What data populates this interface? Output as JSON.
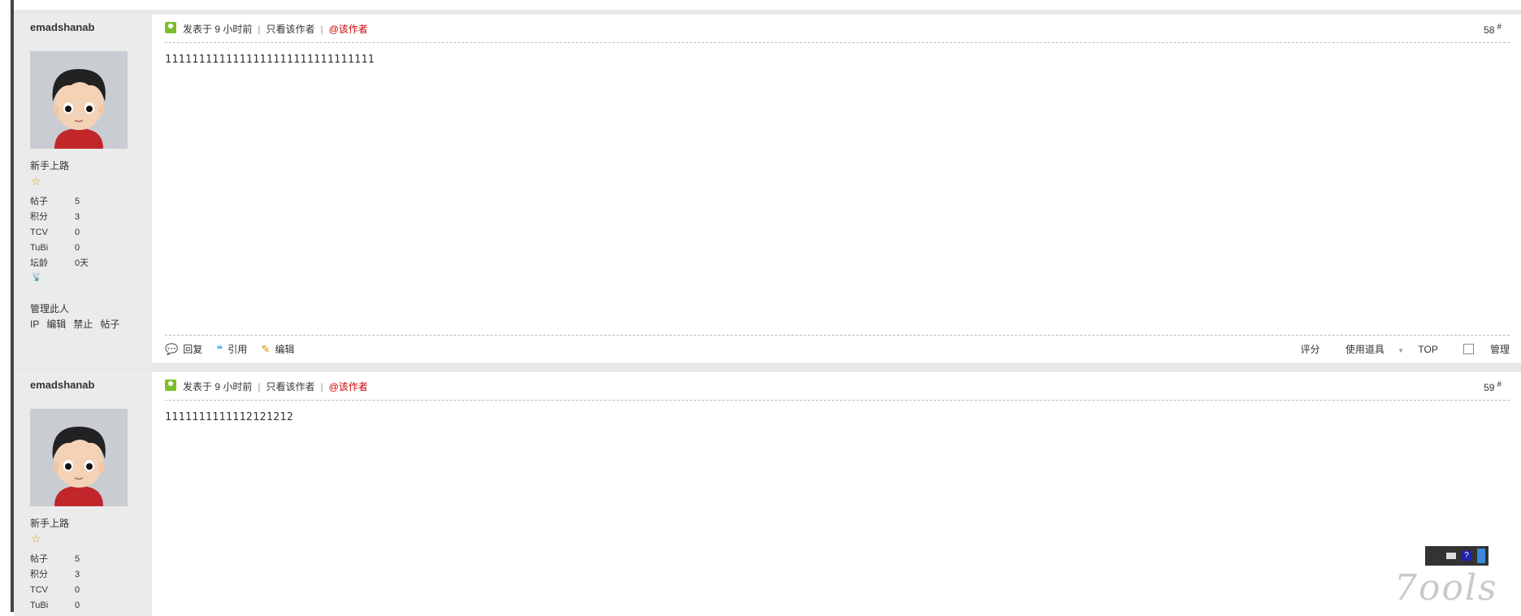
{
  "posts": [
    {
      "author": "emadshanab",
      "rank": "新手上路",
      "stats": [
        {
          "label": "帖子",
          "value": "5"
        },
        {
          "label": "积分",
          "value": "3"
        },
        {
          "label": "TCV",
          "value": "0"
        },
        {
          "label": "TuBi",
          "value": "0"
        },
        {
          "label": "坛龄",
          "value": "0天"
        }
      ],
      "manage_label": "管理此人",
      "admin_links": [
        "IP",
        "编辑",
        "禁止",
        "帖子"
      ],
      "posted": "发表于 9 小时前",
      "only_author": "只看该作者",
      "at_author": "@该作者",
      "floor": "58",
      "floor_mark": "#",
      "content": "1111111111111111111111111111111",
      "actions": {
        "reply": "回复",
        "quote": "引用",
        "edit": "编辑"
      },
      "right_actions": {
        "rate": "评分",
        "tools": "使用道具",
        "top": "TOP",
        "manage": "管理"
      }
    },
    {
      "author": "emadshanab",
      "rank": "新手上路",
      "stats": [
        {
          "label": "帖子",
          "value": "5"
        },
        {
          "label": "积分",
          "value": "3"
        },
        {
          "label": "TCV",
          "value": "0"
        },
        {
          "label": "TuBi",
          "value": "0"
        }
      ],
      "posted": "发表于 9 小时前",
      "only_author": "只看该作者",
      "at_author": "@该作者",
      "floor": "59",
      "floor_mark": "#",
      "content": "1111111111112121212"
    }
  ],
  "watermark": "7ools",
  "colors": {
    "accent_red": "#cc0000",
    "sidebar_bg": "#ebebeb",
    "separator": "#e9e9e9"
  }
}
